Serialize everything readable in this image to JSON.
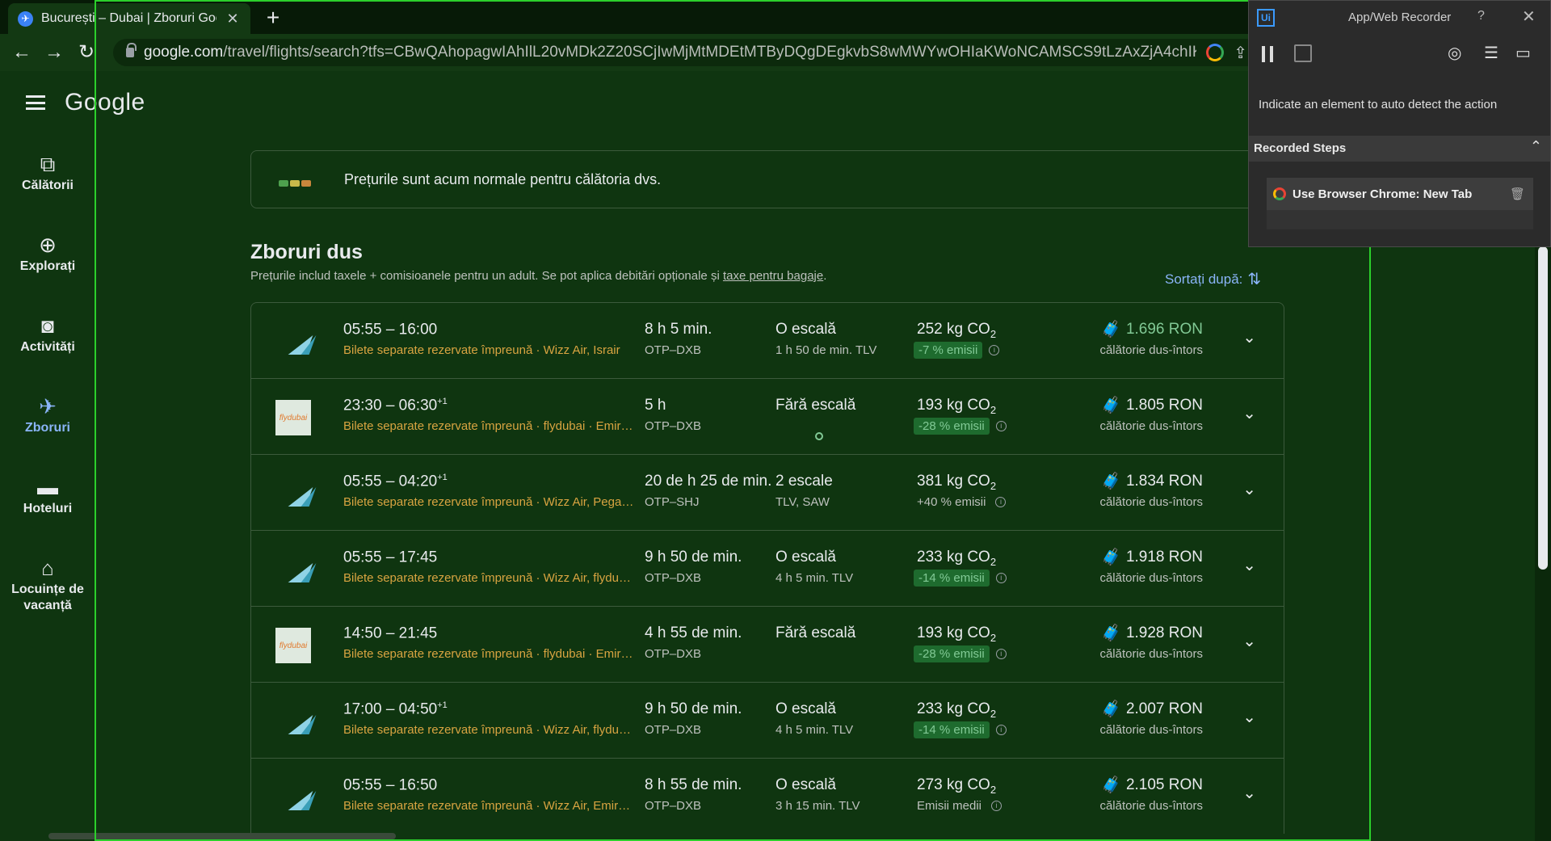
{
  "browser": {
    "tab_title": "București – Dubai | Zboruri Google",
    "tab_close": "✕",
    "new_tab": "+",
    "back": "←",
    "forward": "→",
    "reload": "↻",
    "url_host": "google.com",
    "url_path": "/travel/flights/search?tfs=CBwQAhopagwIAhIlL20vMDk2Z20SCjIwMjMtMDEtMTByDQgDEgkvbS8wMWYwOHIaKWoNCAMSCS9tLzAxZjA4chIKMjAyMy0wM..."
  },
  "google": {
    "logo": "Google"
  },
  "sidebar": {
    "items": [
      {
        "label": "Călătorii",
        "icon": "⧉"
      },
      {
        "label": "Explorați",
        "icon": "⊕"
      },
      {
        "label": "Activități",
        "icon": "◙"
      },
      {
        "label": "Zboruri",
        "icon": "✈"
      },
      {
        "label": "Hoteluri",
        "icon": "▬"
      },
      {
        "label": "Locuințe de vacanță",
        "icon": "⌂"
      }
    ]
  },
  "banner": {
    "text": "Prețurile sunt acum normale pentru călătoria dvs.",
    "chevron": "⌄"
  },
  "section": {
    "title": "Zboruri dus",
    "subtitle": "Prețurile includ taxele + comisioanele pentru un adult. Se pot aplica debitări opționale și ",
    "subtitle_link": "taxe pentru bagaje",
    "subtitle_end": ".",
    "sort_label": "Sortați după:",
    "sort_icon": "⇅"
  },
  "flights": [
    {
      "logo": "wizz",
      "time": "05:55 – 16:00",
      "time_sup": "",
      "carriers": "Bilete separate rezervate împreună · Wizz Air, Israir",
      "duration": "8 h 5 min.",
      "route": "OTP–DXB",
      "stops": "O escală",
      "stop_info": "1 h 50 de min. TLV",
      "co2": "252 kg CO",
      "co2_sub": "2",
      "emissions": "-7 % emisii",
      "emissions_pill": true,
      "price": "1.696 RON",
      "price_green": true,
      "price_sub": "călătorie dus-întors"
    },
    {
      "logo": "flydubai",
      "time": "23:30 – 06:30",
      "time_sup": "+1",
      "carriers": "Bilete separate rezervate împreună · flydubai · Emirates",
      "duration": "5 h",
      "route": "OTP–DXB",
      "stops": "Fără escală",
      "stop_info": "",
      "co2": "193 kg CO",
      "co2_sub": "2",
      "emissions": "-28 % emisii",
      "emissions_pill": true,
      "price": "1.805 RON",
      "price_green": false,
      "price_sub": "călătorie dus-întors"
    },
    {
      "logo": "wizz",
      "time": "05:55 – 04:20",
      "time_sup": "+1",
      "carriers": "Bilete separate rezervate împreună · Wizz Air, Pegasus",
      "duration": "20 de h 25 de min.",
      "route": "OTP–SHJ",
      "stops": "2 escale",
      "stop_info": "TLV, SAW",
      "co2": "381 kg CO",
      "co2_sub": "2",
      "emissions": "+40 % emisii",
      "emissions_pill": false,
      "price": "1.834 RON",
      "price_green": false,
      "price_sub": "călătorie dus-întors"
    },
    {
      "logo": "wizz",
      "time": "05:55 – 17:45",
      "time_sup": "",
      "carriers": "Bilete separate rezervate împreună · Wizz Air, flydubai",
      "duration": "9 h 50 de min.",
      "route": "OTP–DXB",
      "stops": "O escală",
      "stop_info": "4 h 5 min. TLV",
      "co2": "233 kg CO",
      "co2_sub": "2",
      "emissions": "-14 % emisii",
      "emissions_pill": true,
      "price": "1.918 RON",
      "price_green": false,
      "price_sub": "călătorie dus-întors"
    },
    {
      "logo": "flydubai",
      "time": "14:50 – 21:45",
      "time_sup": "",
      "carriers": "Bilete separate rezervate împreună · flydubai · Emirates",
      "duration": "4 h 55 de min.",
      "route": "OTP–DXB",
      "stops": "Fără escală",
      "stop_info": "",
      "co2": "193 kg CO",
      "co2_sub": "2",
      "emissions": "-28 % emisii",
      "emissions_pill": true,
      "price": "1.928 RON",
      "price_green": false,
      "price_sub": "călătorie dus-întors"
    },
    {
      "logo": "wizz",
      "time": "17:00 – 04:50",
      "time_sup": "+1",
      "carriers": "Bilete separate rezervate împreună · Wizz Air, flydubai",
      "duration": "9 h 50 de min.",
      "route": "OTP–DXB",
      "stops": "O escală",
      "stop_info": "4 h 5 min. TLV",
      "co2": "233 kg CO",
      "co2_sub": "2",
      "emissions": "-14 % emisii",
      "emissions_pill": true,
      "price": "2.007 RON",
      "price_green": false,
      "price_sub": "călătorie dus-întors"
    },
    {
      "logo": "wizz",
      "time": "05:55 – 16:50",
      "time_sup": "",
      "carriers": "Bilete separate rezervate împreună · Wizz Air, Emirates",
      "duration": "8 h 55 de min.",
      "route": "OTP–DXB",
      "stops": "O escală",
      "stop_info": "3 h 15 min. TLV",
      "co2": "273 kg CO",
      "co2_sub": "2",
      "emissions": "Emisii medii",
      "emissions_pill": false,
      "price": "2.105 RON",
      "price_green": false,
      "price_sub": "călătorie dus-întors"
    }
  ],
  "flydubai_logo_text": "flydubai",
  "recorder": {
    "logo": "Ui",
    "title": "App/Web Recorder",
    "help": "?",
    "close": "✕",
    "hint": "Indicate an element to auto detect the action",
    "steps_title": "Recorded Steps",
    "steps_chevron": "⌃",
    "step_label": "Use Browser Chrome: New Tab",
    "trash": "🗑"
  },
  "colors": {
    "page_bg": "#0f3510",
    "price_green": "#81c995",
    "carrier_text": "#d9a441",
    "highlight_frame": "#2bd02b"
  }
}
